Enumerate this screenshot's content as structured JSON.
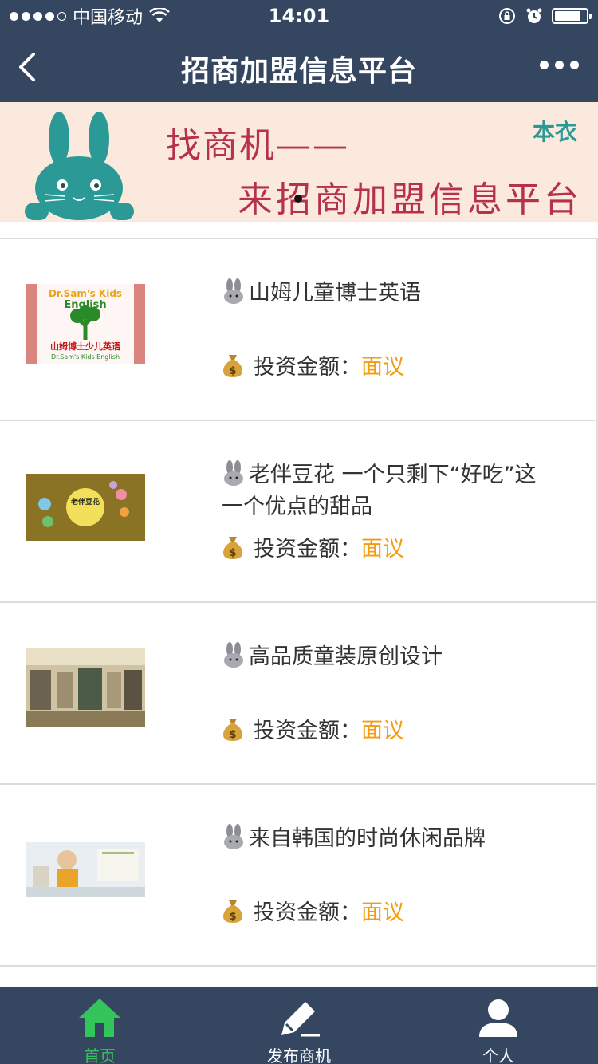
{
  "status_bar": {
    "carrier": "中国移动",
    "time": "14:01"
  },
  "nav": {
    "title": "招商加盟信息平台"
  },
  "banner": {
    "line1": "找商机——",
    "line2": "来招商加盟信息平台",
    "brand": "本衣"
  },
  "items": [
    {
      "title": "山姆儿童博士英语",
      "invest_label": "投资金额：",
      "invest_value": "面议",
      "thumb_text_top": "Dr.Sam's Kids",
      "thumb_text_mid": "English",
      "thumb_text_cn": "山姆博士少儿英语",
      "thumb_text_en": "Dr.Sam's Kids English"
    },
    {
      "title": "老伴豆花 一个只剩下“好吃”这一个优点的甜品",
      "invest_label": "投资金额：",
      "invest_value": "面议",
      "thumb_text_top": "老伴豆花"
    },
    {
      "title": "高品质童装原创设计",
      "invest_label": "投资金额：",
      "invest_value": "面议"
    },
    {
      "title": "来自韩国的时尚休闲品牌",
      "invest_label": "投资金额：",
      "invest_value": "面议"
    }
  ],
  "tabs": [
    {
      "label": "首页",
      "icon": "home-icon",
      "active": true
    },
    {
      "label": "发布商机",
      "icon": "edit-icon",
      "active": false
    },
    {
      "label": "个人",
      "icon": "person-icon",
      "active": false
    }
  ],
  "colors": {
    "header": "#354760",
    "accent_green": "#33c45a",
    "price_orange": "#f39c12",
    "banner_bg": "#fbe9dd",
    "banner_text": "#b5324a",
    "bunny_teal": "#2b9a96"
  }
}
